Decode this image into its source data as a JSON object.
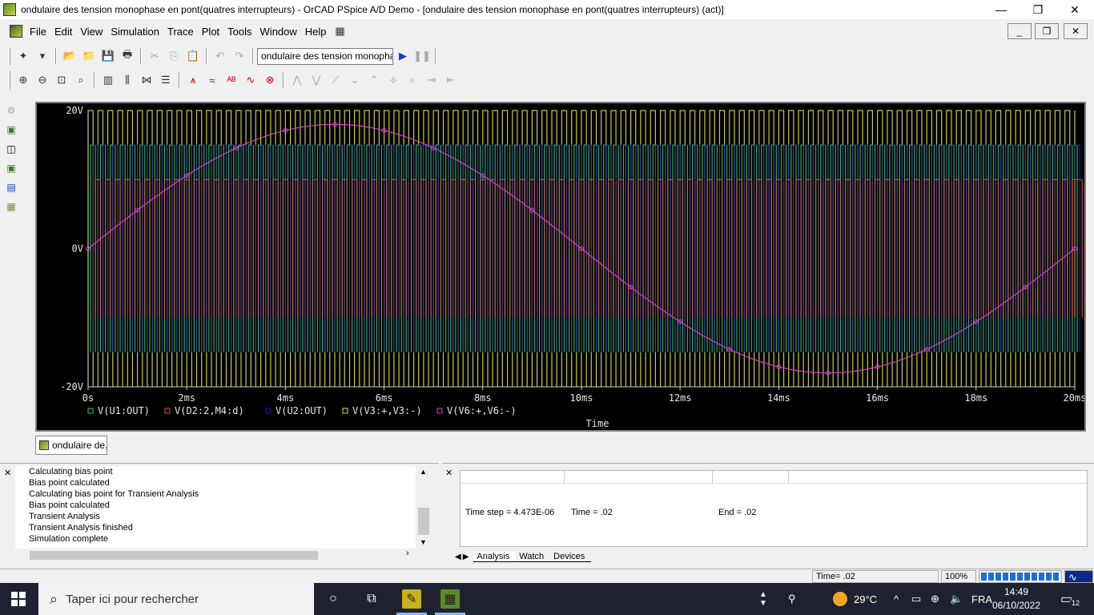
{
  "window": {
    "title": "ondulaire des tension monophase en pont(quatres interrupteurs) - OrCAD PSpice A/D Demo  - [ondulaire des tension monophase en pont(quatres interrupteurs) (act)]",
    "minimize": "—",
    "maximize": "❐",
    "close": "✕"
  },
  "menu": {
    "items": [
      "File",
      "Edit",
      "View",
      "Simulation",
      "Trace",
      "Plot",
      "Tools",
      "Window",
      "Help"
    ],
    "mdi_minimize": "_",
    "mdi_restore": "❐",
    "mdi_close": "✕"
  },
  "toolbar": {
    "profile": "ondulaire des tension monophase"
  },
  "chart_data": {
    "type": "line",
    "xlabel": "Time",
    "ylabel": "",
    "xlim": [
      0,
      20
    ],
    "ylim": [
      -20,
      20
    ],
    "x_ticks": [
      "0s",
      "2ms",
      "4ms",
      "6ms",
      "8ms",
      "10ms",
      "12ms",
      "14ms",
      "16ms",
      "18ms",
      "20ms"
    ],
    "y_ticks": [
      "20V",
      "0V",
      "-20V"
    ],
    "grid": false,
    "series": [
      {
        "name": "V(U1:OUT)",
        "color": "#2ecc40",
        "marker": "square",
        "description_values": {
          "high": 15,
          "low": -15
        }
      },
      {
        "name": "V(D2:2,M4:d)",
        "color": "#e05a2a",
        "marker": "diamond",
        "description_values": {
          "high": 10,
          "low": -10
        }
      },
      {
        "name": "V(U2:OUT)",
        "color": "#2020c0",
        "marker": "triangle-down",
        "description_values": {
          "high": 15,
          "low": -15
        }
      },
      {
        "name": "V(V3:+,V3:-)",
        "color": "#e0e040",
        "marker": "triangle",
        "description_values": {
          "high": 20,
          "low": -20
        }
      },
      {
        "name": "V(V6:+,V6:-)",
        "color": "#d040d0",
        "marker": "circle",
        "amplitude": 18,
        "frequency_hz": 50
      }
    ]
  },
  "doc_tab": {
    "label": "ondulaire de..."
  },
  "output_log": {
    "lines": [
      "Calculating bias point",
      "Bias point calculated",
      "Calculating bias point for Transient Analysis",
      "Bias point calculated",
      "Transient Analysis",
      "Transient Analysis finished",
      "Simulation complete"
    ]
  },
  "sim_status": {
    "time_step": "Time step =  4.473E-06",
    "time": "Time =  .02",
    "end": "End =  .02",
    "tabs": [
      "Analysis",
      "Watch",
      "Devices"
    ]
  },
  "statusbar": {
    "time": "Time= .02",
    "zoom": "100%"
  },
  "taskbar": {
    "search_placeholder": "Taper ici pour rechercher",
    "temperature": "29°C",
    "language": "FRA",
    "time": "14:49",
    "date": "06/10/2022",
    "notifications": "12"
  }
}
